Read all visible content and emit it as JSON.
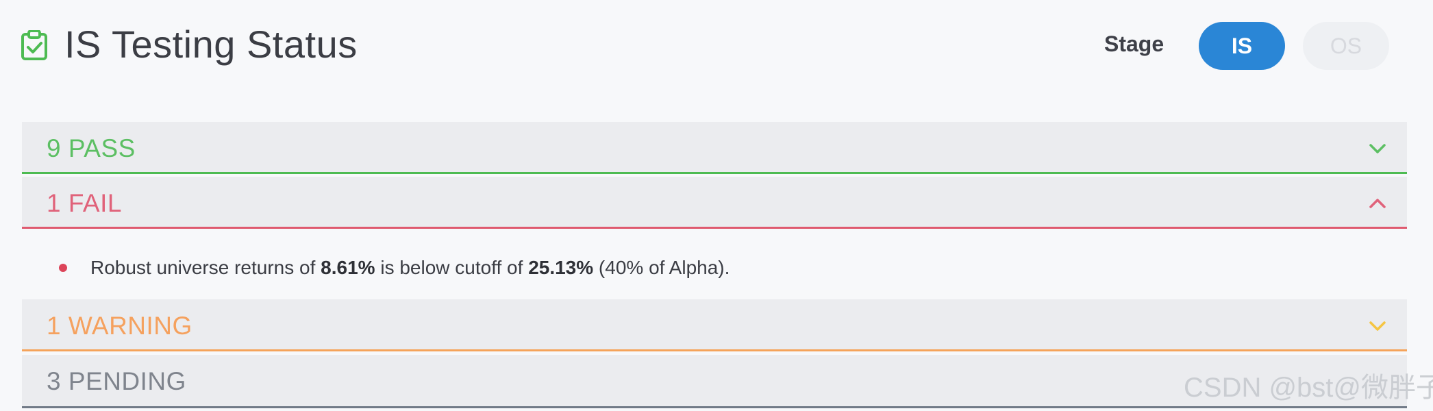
{
  "header": {
    "title": "IS Testing Status",
    "title_icon": "clipboard-check-icon",
    "stage_label": "Stage",
    "stage_options": [
      {
        "label": "IS",
        "selected": true
      },
      {
        "label": "OS",
        "selected": false
      }
    ]
  },
  "sections": {
    "pass": {
      "label": "9 PASS",
      "expanded": false,
      "icon": "chevron-down-icon",
      "color": "#4dbb52"
    },
    "fail": {
      "label": "1 FAIL",
      "expanded": true,
      "icon": "chevron-up-icon",
      "color": "#df5a6f",
      "items": [
        {
          "prefix": "Robust universe returns of ",
          "value": "8.61%",
          "middle": " is below cutoff of ",
          "cutoff": "25.13%",
          "suffix": " (40% of Alpha)."
        }
      ]
    },
    "warning": {
      "label": "1 WARNING",
      "expanded": false,
      "icon": "chevron-down-icon",
      "color": "#f5a35a"
    },
    "pending": {
      "label": "3 PENDING",
      "expanded": false,
      "color": "#717a87"
    }
  },
  "watermark": "CSDN @bst@微胖子",
  "colors": {
    "accent": "#2a86d6",
    "pass": "#4dbb52",
    "fail": "#df5a6f",
    "warning": "#f5a35a",
    "pending": "#717a87"
  }
}
